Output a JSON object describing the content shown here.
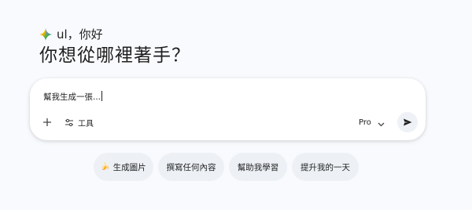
{
  "greeting": {
    "icon": "gemini-spark-icon",
    "text": "ul，你好"
  },
  "headline": "你想從哪裡著手？",
  "composer": {
    "input_value": "幫我生成一張...",
    "add_icon": "plus-icon",
    "tools_icon": "tune-icon",
    "tools_label": "工具",
    "model_label": "Pro",
    "model_dropdown_icon": "chevron-down-icon",
    "send_icon": "send-icon"
  },
  "suggestions": [
    {
      "emoji": "🍌",
      "label": "生成圖片"
    },
    {
      "label": "撰寫任何內容"
    },
    {
      "label": "幫助我學習"
    },
    {
      "label": "提升我的一天"
    }
  ],
  "colors": {
    "background": "#f8fafd",
    "composer": "#ffffff",
    "chip": "#edf1f6",
    "send_button": "#eef1f6",
    "text": "#1f1f1f",
    "spark_blue": "#4285f4",
    "spark_red": "#ea4335",
    "spark_yellow": "#fbbc04",
    "spark_green": "#34a853"
  }
}
